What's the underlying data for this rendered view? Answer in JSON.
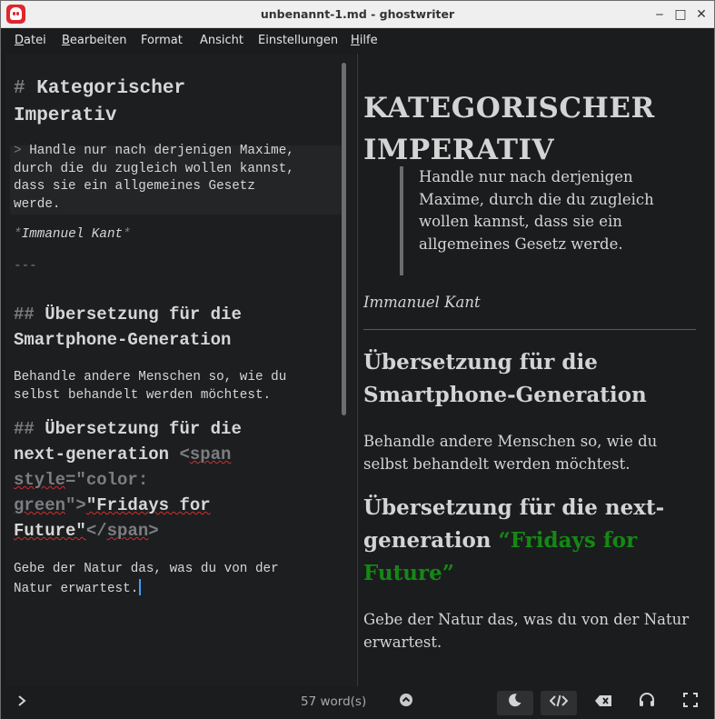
{
  "window": {
    "title": "unbenannt-1.md - ghostwriter",
    "controls": {
      "minimize": "‒",
      "maximize": "□",
      "close": "✕"
    }
  },
  "menu": [
    {
      "label": "Datei",
      "key": "D",
      "rest": "atei"
    },
    {
      "label": "Bearbeiten",
      "key": "B",
      "rest": "earbeiten"
    },
    {
      "label": "Format",
      "key": "",
      "rest": "Format"
    },
    {
      "label": "Ansicht",
      "key": "",
      "rest": "Ansicht"
    },
    {
      "label": "Einstellungen",
      "key": "",
      "rest": "Einstellungen"
    },
    {
      "label": "Hilfe",
      "key": "H",
      "rest": "ilfe"
    }
  ],
  "editor": {
    "h1_marker": "#",
    "h1_line1": "Kategorischer",
    "h1_line2": "Imperativ",
    "quote_marker": ">",
    "quote_line1": "Handle nur nach derjenigen Maxime,",
    "quote_line2": "durch die du zugleich wollen kannst,",
    "quote_line3": "dass sie ein allgemeines Gesetz",
    "quote_line4": "werde.",
    "emph_marker": "*",
    "author": "Immanuel Kant",
    "hr": "---",
    "h2a_marker": "##",
    "h2a_line1": "Übersetzung für die",
    "h2a_line2": "Smartphone-Generation",
    "p1_line1": "Behandle andere Menschen so, wie du",
    "p1_line2": "selbst behandelt werden möchtest.",
    "h2b_marker": "##",
    "h2b_line1": "Übersetzung für die",
    "h2b_line2a": "next-generation",
    "h2b_tag_open": "<",
    "h2b_span": "span",
    "h2b_style": "style",
    "h2b_attr_val1": "=\"color:",
    "h2b_green": "green",
    "h2b_attr_close": "\">",
    "h2b_fridays": "\"Fridays for",
    "h2b_future": "Future\"",
    "h2b_close_open": "</",
    "h2b_close_span": "span",
    "h2b_close_gt": ">",
    "p2_line1": "Gebe der Natur das, was du von der",
    "p2_line2": "Natur erwartest."
  },
  "preview": {
    "h1": "KATEGORISCHER IMPERATIV",
    "quote": "Handle nur nach derjenigen Maxime, durch die du zugleich wollen kannst, dass sie ein allgemeines Gesetz werde.",
    "author": "Immanuel Kant",
    "h2a": "Übersetzung für die Smartphone-Generation",
    "p1": "Behandle andere Menschen so, wie du selbst behandelt werden möchtest.",
    "h2b_plain": "Übersetzung für die next-generation",
    "h2b_green": "“Fridays for Future”",
    "p2": "Gebe der Natur das, was du von der Natur erwartest.",
    "accent_green": "#138913"
  },
  "statusbar": {
    "word_count": "57 word(s)",
    "icons": [
      "chevron-right-icon",
      "chevron-up-circle-icon",
      "moon-icon",
      "code-icon",
      "backspace-icon",
      "headphones-icon",
      "fullscreen-icon"
    ]
  }
}
